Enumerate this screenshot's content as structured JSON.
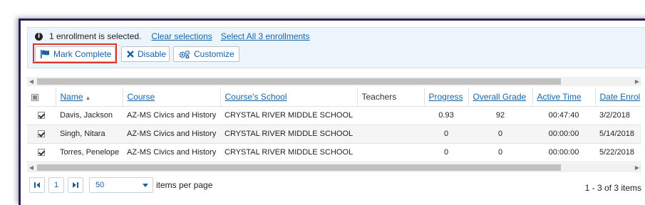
{
  "selection": {
    "message": "1 enrollment is selected.",
    "clear_link": "Clear selections",
    "select_all_link": "Select All 3 enrollments"
  },
  "toolbar": {
    "mark_complete": "Mark Complete",
    "disable": "Disable",
    "customize": "Customize"
  },
  "columns": [
    "Name",
    "Course",
    "Course's School",
    "Teachers",
    "Progress",
    "Overall Grade",
    "Active Time",
    "Date Enrol"
  ],
  "rows": [
    {
      "checked": true,
      "name": "Davis, Jackson",
      "course": "AZ-MS Civics and History",
      "school": "CRYSTAL RIVER MIDDLE SCHOOL",
      "teachers": "",
      "progress": "0.93",
      "grade": "92",
      "active_time": "00:47:40",
      "date": "3/2/2018"
    },
    {
      "checked": true,
      "name": "Singh, Nitara",
      "course": "AZ-MS Civics and History",
      "school": "CRYSTAL RIVER MIDDLE SCHOOL",
      "teachers": "",
      "progress": "0",
      "grade": "0",
      "active_time": "00:00:00",
      "date": "5/14/2018"
    },
    {
      "checked": true,
      "name": "Torres, Penelope",
      "course": "AZ-MS Civics and History",
      "school": "CRYSTAL RIVER MIDDLE SCHOOL",
      "teachers": "",
      "progress": "0",
      "grade": "0",
      "active_time": "00:00:00",
      "date": "5/22/2018"
    }
  ],
  "pager": {
    "current_page": "1",
    "page_size": "50",
    "items_per_page_label": "items per page",
    "range_text": "1 - 3 of 3 items"
  },
  "colors": {
    "link": "#1764a8",
    "highlight": "#e0342b",
    "selection_bg": "#edf5fc"
  }
}
